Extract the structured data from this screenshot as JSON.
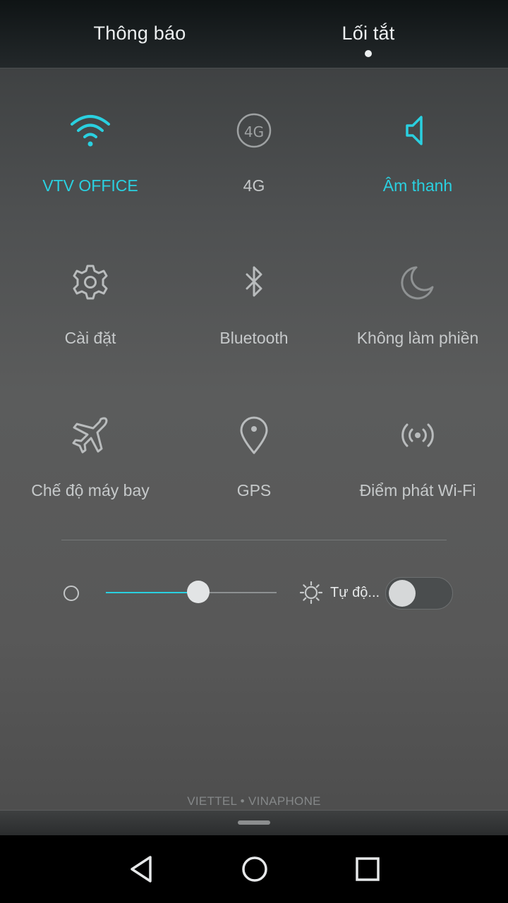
{
  "tabs": [
    {
      "label": "Thông báo",
      "active": false
    },
    {
      "label": "Lối tắt",
      "active": true
    }
  ],
  "tiles": [
    {
      "label": "VTV OFFICE",
      "icon": "wifi-icon",
      "active": true
    },
    {
      "label": "4G",
      "icon": "4g-icon",
      "active": false
    },
    {
      "label": "Âm thanh",
      "icon": "speaker-icon",
      "active": true
    },
    {
      "label": "Cài đặt",
      "icon": "gear-icon",
      "active": false
    },
    {
      "label": "Bluetooth",
      "icon": "bluetooth-icon",
      "active": false
    },
    {
      "label": "Không làm phiền",
      "icon": "moon-icon",
      "active": false
    },
    {
      "label": "Chế độ máy bay",
      "icon": "airplane-icon",
      "active": false
    },
    {
      "label": "GPS",
      "icon": "location-pin-icon",
      "active": false
    },
    {
      "label": "Điểm phát Wi-Fi",
      "icon": "hotspot-icon",
      "active": false
    }
  ],
  "brightness": {
    "level": 0.54,
    "auto_label": "Tự độ...",
    "auto_enabled": false
  },
  "carrier": "VIETTEL • VINAPHONE",
  "nav": {
    "back_icon": "back-triangle-icon",
    "home_icon": "home-circle-icon",
    "recents_icon": "recents-square-icon"
  },
  "colors": {
    "accent": "#2ad0e0",
    "inactive": "#c6c9ca"
  }
}
